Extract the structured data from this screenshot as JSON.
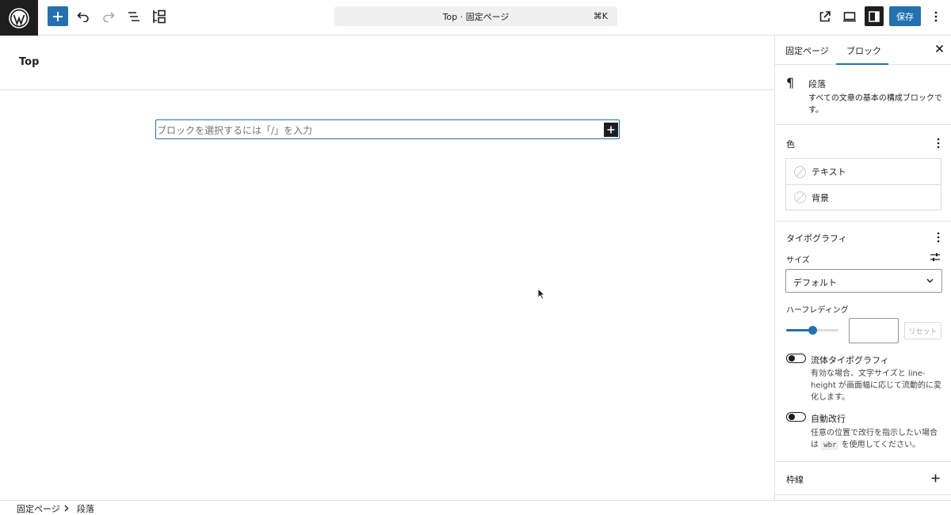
{
  "topbar": {
    "command_title": "Top · 固定ページ",
    "command_shortcut": "⌘K",
    "save_label": "保存"
  },
  "canvas": {
    "page_title": "Top",
    "block_placeholder": "ブロックを選択するには「/」を入力"
  },
  "sidebar": {
    "tabs": [
      "固定ページ",
      "ブロック"
    ],
    "block_name": "段落",
    "block_description": "すべての文章の基本の構成ブロックです。",
    "color": {
      "title": "色",
      "items": [
        "テキスト",
        "背景"
      ]
    },
    "typography": {
      "title": "タイポグラフィ",
      "size_label": "サイズ",
      "size_value": "デフォルト",
      "line_height_label": "ハーフレディング",
      "line_height_value": "",
      "line_height_level": 0.5,
      "reset_label": "リセット",
      "fluid_label": "流体タイポグラフィ",
      "fluid_help": "有効な場合、文字サイズと line-height が画面幅に応じて流動的に変化します。",
      "wrap_label": "自動改行",
      "wrap_help_before": "任意の位置で改行を指示したい場合は",
      "wrap_help_code": "wbr",
      "wrap_help_after": "を使用してください。"
    },
    "border": {
      "title": "枠線"
    }
  },
  "footer": {
    "breadcrumb": [
      "固定ページ",
      "段落"
    ]
  }
}
